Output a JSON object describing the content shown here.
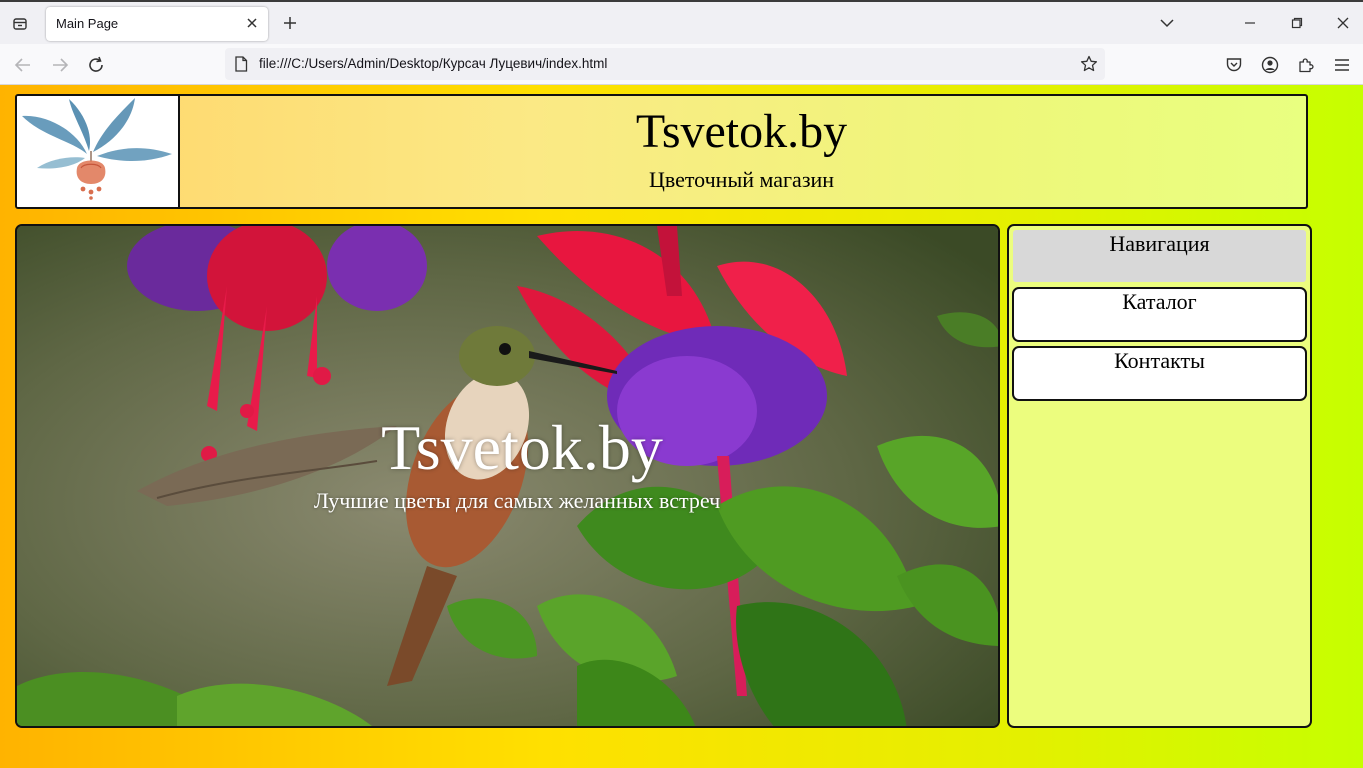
{
  "browser": {
    "tab_title": "Main Page",
    "url": "file:///C:/Users/Admin/Desktop/Курсач Луцевич/index.html"
  },
  "header": {
    "title": "Tsvetok.by",
    "subtitle": "Цветочный магазин"
  },
  "hero": {
    "title": "Tsvetok.by",
    "tagline": "Лучшие цветы для самых желанных встреч"
  },
  "sidebar": {
    "heading": "Навигация",
    "links": [
      {
        "label": "Каталог"
      },
      {
        "label": "Контакты"
      }
    ]
  }
}
